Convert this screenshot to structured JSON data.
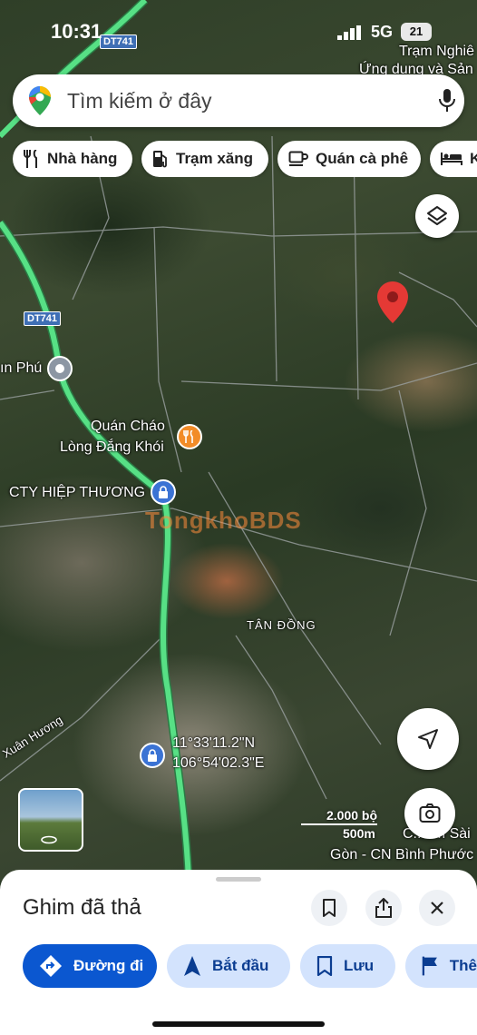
{
  "status_bar": {
    "time": "10:31",
    "network": "5G",
    "battery": "21"
  },
  "search": {
    "placeholder": "Tìm kiếm ở đây"
  },
  "chips": [
    {
      "label": "Nhà hàng",
      "icon": "restaurant-icon"
    },
    {
      "label": "Trạm xăng",
      "icon": "gas-station-icon"
    },
    {
      "label": "Quán cà phê",
      "icon": "coffee-icon"
    },
    {
      "label": "K",
      "icon": "hotel-icon"
    }
  ],
  "map": {
    "road_shields": [
      "DT741",
      "DT741"
    ],
    "labels": {
      "tram_nghiep": "Trạm Nghiê",
      "ung_dung": "Ứng dụng và Sản",
      "an_phu": "ın Phú",
      "quan_chao": "Quán Cháo",
      "long_dang_khoi": "Lòng Đắng Khói",
      "cty": "CTY HIỆP THƯƠNG",
      "watermark": "TongkhoBDS",
      "tan_dong": "TÂN ĐỒNG",
      "xuan_huong": "Xuân Hương",
      "coord_lat": "11°33'11.2\"N",
      "coord_lon": "106°54'02.3\"E",
      "cn_name_1": "C...em Sài",
      "cn_name_2": "Gòn - CN Bình Phước"
    },
    "scale": {
      "primary": "2.000 bộ",
      "secondary": "500m"
    },
    "pin_color": "#e53935",
    "route_color": "#4fd97a"
  },
  "sheet": {
    "title": "Ghim đã thả",
    "actions": [
      {
        "label": "Đường đi",
        "icon": "directions-icon"
      },
      {
        "label": "Bắt đầu",
        "icon": "navigation-arrow-icon"
      },
      {
        "label": "Lưu",
        "icon": "bookmark-icon"
      },
      {
        "label": "Thê",
        "icon": "flag-icon"
      }
    ],
    "primary_color": "#0b57d0",
    "secondary_color": "#d3e3fd"
  }
}
